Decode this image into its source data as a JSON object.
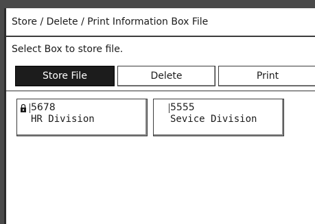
{
  "header": {
    "title": "Store / Delete / Print Information Box File"
  },
  "message": {
    "text": "Select Box to store file."
  },
  "actions": {
    "store_label": "Store File",
    "delete_label": "Delete",
    "print_label": "Print",
    "selected": "Store File"
  },
  "boxes": [
    {
      "number": "5678",
      "name": "HR Division",
      "icon": "lock-icon"
    },
    {
      "number": "5555",
      "name": "Sevice Division",
      "icon": ""
    }
  ]
}
